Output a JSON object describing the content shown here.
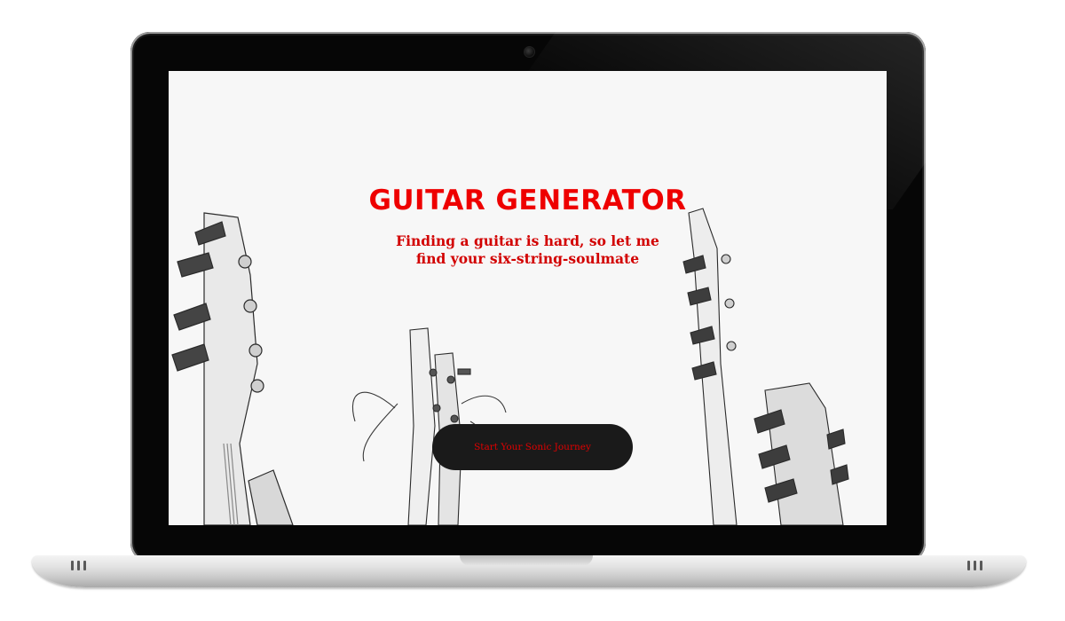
{
  "page": {
    "title": "GUITAR GENERATOR",
    "subtitle_line1": "Finding a guitar is hard, so let me",
    "subtitle_line2": "find your six-string-soulmate",
    "cta_label": "Start Your Sonic Journey"
  },
  "colors": {
    "accent": "#ee0000",
    "button_bg": "#1a1a1a",
    "screen_bg": "#f7f7f7"
  },
  "images": {
    "background": "black-and-white-guitar-headstocks-photo"
  }
}
